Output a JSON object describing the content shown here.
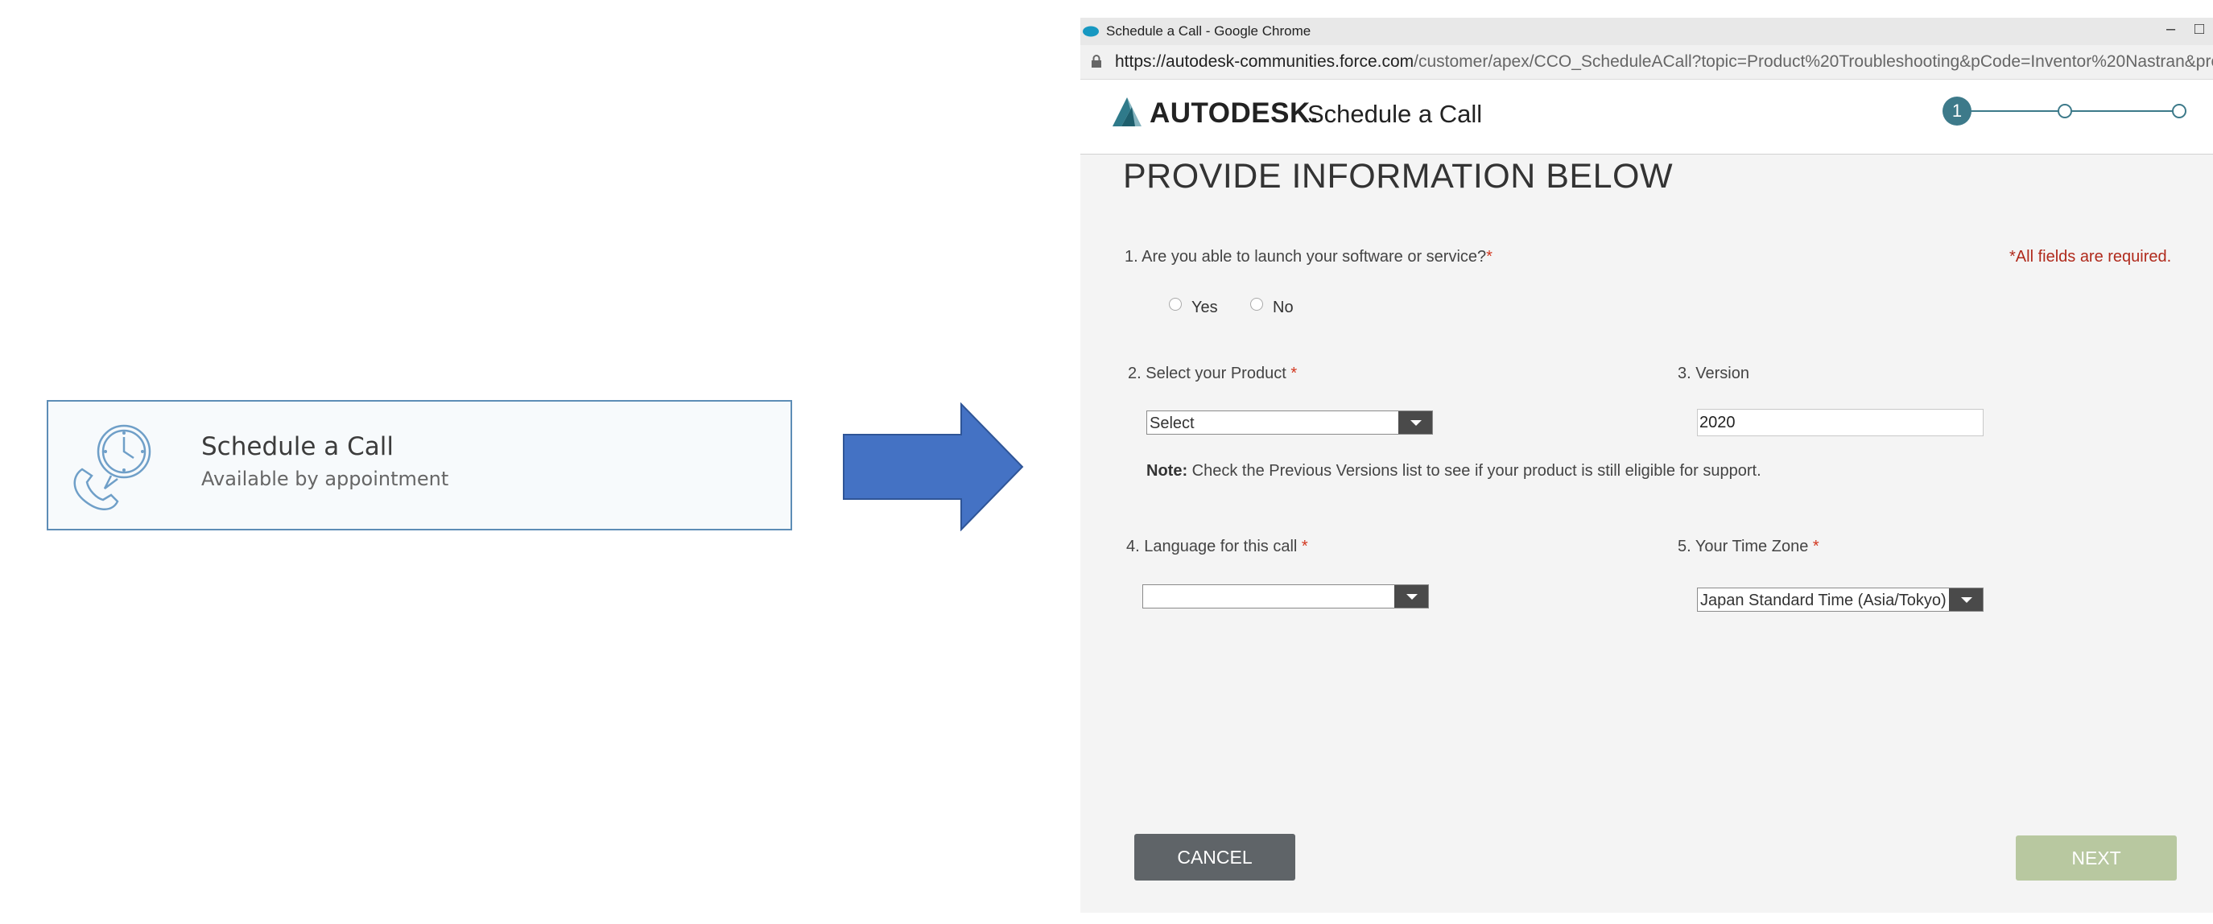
{
  "card": {
    "title": "Schedule a Call",
    "subtitle": "Available by appointment",
    "icon": "phone-clock-icon"
  },
  "arrow": {
    "color": "#4472c4",
    "icon": "right-arrow-icon"
  },
  "browser": {
    "window_title": "Schedule a Call - Google Chrome",
    "url_host": "https://autodesk-communities.force.com",
    "url_path": "/customer/apex/CCO_ScheduleACall?topic=Product%20Troubleshooting&pCode=Inventor%20Nastran&productC..."
  },
  "header": {
    "brand": "AUTODESK.",
    "title": "Schedule a Call",
    "current_step": "1"
  },
  "form": {
    "heading": "PROVIDE INFORMATION BELOW",
    "required_note": "*All fields are required.",
    "q1": {
      "label": "1. Are you able to launch your software or service?",
      "required": "*",
      "yes": "Yes",
      "no": "No"
    },
    "q2": {
      "label": "2. Select your Product ",
      "required": "*",
      "value": "Select"
    },
    "q3": {
      "label": "3. Version",
      "value": "2020"
    },
    "note_bold": "Note:",
    "note_text": " Check the Previous Versions list to see if your product is still eligible for support.",
    "q4": {
      "label": "4. Language for this call ",
      "required": "*",
      "value": ""
    },
    "q5": {
      "label": "5. Your Time Zone ",
      "required": "*",
      "value": "Japan Standard Time (Asia/Tokyo)"
    }
  },
  "buttons": {
    "cancel": "CANCEL",
    "next": "NEXT"
  },
  "colors": {
    "accent": "#3d7a8a",
    "cancel_bg": "#5f6468",
    "next_bg": "#b8c8a0",
    "required": "#d2361e"
  }
}
